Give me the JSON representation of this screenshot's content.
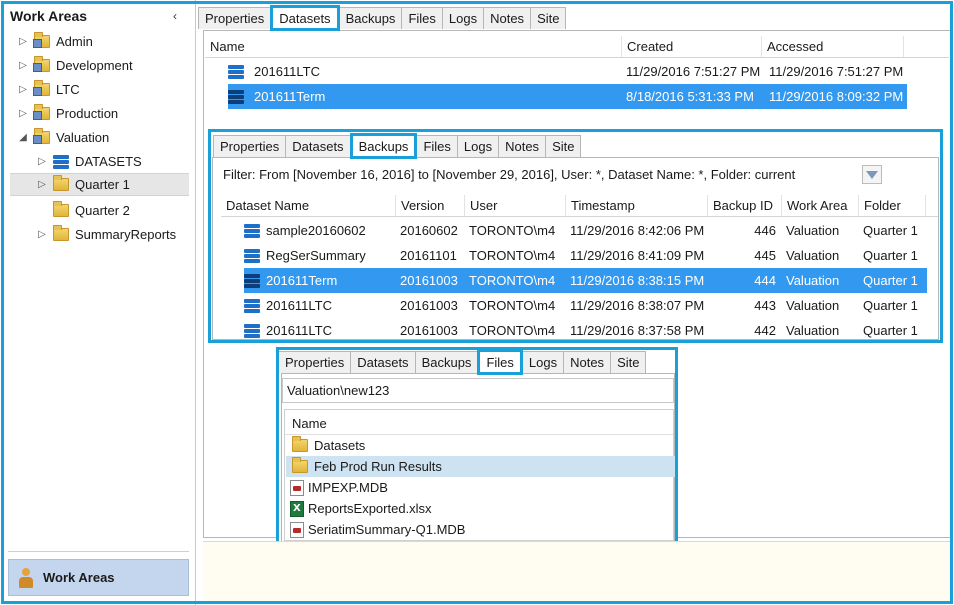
{
  "sidebar": {
    "title": "Work Areas",
    "collapse_glyph": "‹",
    "tree": [
      {
        "label": "Admin",
        "expander": "▷"
      },
      {
        "label": "Development",
        "expander": "▷"
      },
      {
        "label": "LTC",
        "expander": "▷"
      },
      {
        "label": "Production",
        "expander": "▷"
      },
      {
        "label": "Valuation",
        "expander": "◢"
      },
      {
        "label": "DATASETS",
        "expander": "▷"
      },
      {
        "label": "Quarter 1",
        "expander": "▷"
      },
      {
        "label": "Quarter 2",
        "expander": ""
      },
      {
        "label": "SummaryReports",
        "expander": "▷"
      }
    ],
    "footer_label": "Work Areas"
  },
  "main_tabs": [
    "Properties",
    "Datasets",
    "Backups",
    "Files",
    "Logs",
    "Notes",
    "Site"
  ],
  "datasets_grid": {
    "columns": [
      "Name",
      "Created",
      "Accessed"
    ],
    "rows": [
      {
        "name": "201611LTC",
        "created": "11/29/2016 7:51:27 PM",
        "accessed": "11/29/2016 7:51:27 PM"
      },
      {
        "name": "201611Term",
        "created": "8/18/2016 5:31:33 PM",
        "accessed": "11/29/2016 8:09:32 PM"
      }
    ]
  },
  "backups_panel": {
    "tabs": [
      "Properties",
      "Datasets",
      "Backups",
      "Files",
      "Logs",
      "Notes",
      "Site"
    ],
    "filter_text": "Filter: From [November 16, 2016] to [November 29, 2016], User: *, Dataset Name: *, Folder: current",
    "columns": [
      "Dataset Name",
      "Version",
      "User",
      "Timestamp",
      "Backup ID",
      "Work Area",
      "Folder"
    ],
    "rows": [
      {
        "name": "sample20160602",
        "version": "20160602",
        "user": "TORONTO\\m4",
        "timestamp": "11/29/2016 8:42:06 PM",
        "backup_id": "446",
        "work_area": "Valuation",
        "folder": "Quarter 1"
      },
      {
        "name": "RegSerSummary",
        "version": "20161101",
        "user": "TORONTO\\m4",
        "timestamp": "11/29/2016 8:41:09 PM",
        "backup_id": "445",
        "work_area": "Valuation",
        "folder": "Quarter 1"
      },
      {
        "name": "201611Term",
        "version": "20161003",
        "user": "TORONTO\\m4",
        "timestamp": "11/29/2016 8:38:15 PM",
        "backup_id": "444",
        "work_area": "Valuation",
        "folder": "Quarter 1"
      },
      {
        "name": "201611LTC",
        "version": "20161003",
        "user": "TORONTO\\m4",
        "timestamp": "11/29/2016 8:38:07 PM",
        "backup_id": "443",
        "work_area": "Valuation",
        "folder": "Quarter 1"
      },
      {
        "name": "201611LTC",
        "version": "20161003",
        "user": "TORONTO\\m4",
        "timestamp": "11/29/2016 8:37:58 PM",
        "backup_id": "442",
        "work_area": "Valuation",
        "folder": "Quarter 1"
      }
    ]
  },
  "files_panel": {
    "tabs": [
      "Properties",
      "Datasets",
      "Backups",
      "Files",
      "Logs",
      "Notes",
      "Site"
    ],
    "path": "Valuation\\new123",
    "column": "Name",
    "items": [
      {
        "label": "Datasets",
        "icon": "folder-icon"
      },
      {
        "label": "Feb Prod Run Results",
        "icon": "folder-icon"
      },
      {
        "label": "IMPEXP.MDB",
        "icon": "mdb-file-icon"
      },
      {
        "label": "ReportsExported.xlsx",
        "icon": "excel-file-icon"
      },
      {
        "label": "SeriatimSummary-Q1.MDB",
        "icon": "mdb-file-icon"
      }
    ]
  }
}
